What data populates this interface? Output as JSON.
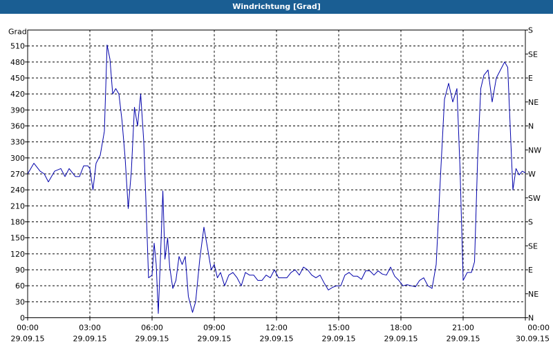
{
  "window": {
    "title": "Windrichtung [Grad]"
  },
  "chart_data": {
    "type": "line",
    "ylabel": "Grad",
    "ylim": [
      0,
      540
    ],
    "yticks": [
      0,
      30,
      60,
      90,
      120,
      150,
      180,
      210,
      240,
      270,
      300,
      330,
      360,
      390,
      420,
      450,
      480,
      510
    ],
    "right_ticks": [
      {
        "value": 0,
        "label": "N"
      },
      {
        "value": 45,
        "label": "NE"
      },
      {
        "value": 90,
        "label": "E"
      },
      {
        "value": 135,
        "label": "SE"
      },
      {
        "value": 180,
        "label": "S"
      },
      {
        "value": 225,
        "label": "SW"
      },
      {
        "value": 270,
        "label": "W"
      },
      {
        "value": 315,
        "label": "NW"
      },
      {
        "value": 360,
        "label": "N"
      },
      {
        "value": 405,
        "label": "NE"
      },
      {
        "value": 450,
        "label": "E"
      },
      {
        "value": 495,
        "label": "SE"
      },
      {
        "value": 540,
        "label": "S"
      }
    ],
    "xlim_hours": [
      0,
      24
    ],
    "xticks": [
      {
        "hour": 0,
        "time": "00:00",
        "date": "29.09.15"
      },
      {
        "hour": 3,
        "time": "03:00",
        "date": "29.09.15"
      },
      {
        "hour": 6,
        "time": "06:00",
        "date": "29.09.15"
      },
      {
        "hour": 9,
        "time": "09:00",
        "date": "29.09.15"
      },
      {
        "hour": 12,
        "time": "12:00",
        "date": "29.09.15"
      },
      {
        "hour": 15,
        "time": "15:00",
        "date": "29.09.15"
      },
      {
        "hour": 18,
        "time": "18:00",
        "date": "29.09.15"
      },
      {
        "hour": 21,
        "time": "21:00",
        "date": "29.09.15"
      },
      {
        "hour": 24,
        "time": "00:00",
        "date": "30.09.15"
      }
    ],
    "grid": true,
    "series": [
      {
        "color": "#0000aa",
        "points": [
          [
            0.0,
            270
          ],
          [
            0.3,
            290
          ],
          [
            0.6,
            275
          ],
          [
            0.8,
            270
          ],
          [
            1.0,
            255
          ],
          [
            1.3,
            275
          ],
          [
            1.6,
            280
          ],
          [
            1.8,
            265
          ],
          [
            2.0,
            280
          ],
          [
            2.3,
            265
          ],
          [
            2.5,
            265
          ],
          [
            2.7,
            285
          ],
          [
            2.9,
            285
          ],
          [
            3.0,
            280
          ],
          [
            3.15,
            240
          ],
          [
            3.3,
            290
          ],
          [
            3.5,
            305
          ],
          [
            3.7,
            350
          ],
          [
            3.83,
            512
          ],
          [
            3.97,
            485
          ],
          [
            4.1,
            420
          ],
          [
            4.25,
            430
          ],
          [
            4.4,
            420
          ],
          [
            4.55,
            370
          ],
          [
            4.7,
            300
          ],
          [
            4.85,
            205
          ],
          [
            5.0,
            275
          ],
          [
            5.15,
            395
          ],
          [
            5.3,
            360
          ],
          [
            5.45,
            420
          ],
          [
            5.6,
            330
          ],
          [
            5.72,
            200
          ],
          [
            5.83,
            75
          ],
          [
            6.0,
            80
          ],
          [
            6.1,
            140
          ],
          [
            6.2,
            100
          ],
          [
            6.3,
            8
          ],
          [
            6.42,
            130
          ],
          [
            6.52,
            238
          ],
          [
            6.62,
            110
          ],
          [
            6.75,
            150
          ],
          [
            6.85,
            95
          ],
          [
            7.0,
            55
          ],
          [
            7.15,
            70
          ],
          [
            7.3,
            115
          ],
          [
            7.45,
            100
          ],
          [
            7.6,
            115
          ],
          [
            7.75,
            40
          ],
          [
            7.95,
            10
          ],
          [
            8.1,
            30
          ],
          [
            8.3,
            110
          ],
          [
            8.5,
            170
          ],
          [
            8.7,
            125
          ],
          [
            8.85,
            90
          ],
          [
            9.0,
            100
          ],
          [
            9.15,
            75
          ],
          [
            9.3,
            85
          ],
          [
            9.5,
            60
          ],
          [
            9.7,
            80
          ],
          [
            9.9,
            85
          ],
          [
            10.1,
            75
          ],
          [
            10.3,
            60
          ],
          [
            10.5,
            85
          ],
          [
            10.7,
            80
          ],
          [
            10.9,
            80
          ],
          [
            11.1,
            70
          ],
          [
            11.3,
            70
          ],
          [
            11.5,
            80
          ],
          [
            11.7,
            75
          ],
          [
            11.9,
            90
          ],
          [
            12.1,
            75
          ],
          [
            12.3,
            75
          ],
          [
            12.5,
            75
          ],
          [
            12.7,
            85
          ],
          [
            12.9,
            90
          ],
          [
            13.1,
            80
          ],
          [
            13.3,
            95
          ],
          [
            13.5,
            90
          ],
          [
            13.7,
            80
          ],
          [
            13.9,
            75
          ],
          [
            14.1,
            80
          ],
          [
            14.3,
            65
          ],
          [
            14.5,
            52
          ],
          [
            14.7,
            57
          ],
          [
            14.9,
            60
          ],
          [
            15.1,
            60
          ],
          [
            15.3,
            80
          ],
          [
            15.5,
            85
          ],
          [
            15.7,
            78
          ],
          [
            15.9,
            78
          ],
          [
            16.1,
            72
          ],
          [
            16.3,
            88
          ],
          [
            16.5,
            88
          ],
          [
            16.7,
            80
          ],
          [
            16.9,
            88
          ],
          [
            17.1,
            82
          ],
          [
            17.3,
            80
          ],
          [
            17.5,
            95
          ],
          [
            17.7,
            78
          ],
          [
            17.9,
            70
          ],
          [
            18.1,
            60
          ],
          [
            18.3,
            62
          ],
          [
            18.5,
            60
          ],
          [
            18.7,
            58
          ],
          [
            18.9,
            70
          ],
          [
            19.1,
            75
          ],
          [
            19.3,
            60
          ],
          [
            19.5,
            55
          ],
          [
            19.7,
            100
          ],
          [
            19.9,
            260
          ],
          [
            20.1,
            410
          ],
          [
            20.3,
            440
          ],
          [
            20.5,
            405
          ],
          [
            20.7,
            430
          ],
          [
            20.85,
            280
          ],
          [
            21.0,
            70
          ],
          [
            21.2,
            85
          ],
          [
            21.4,
            85
          ],
          [
            21.55,
            105
          ],
          [
            21.7,
            300
          ],
          [
            21.85,
            430
          ],
          [
            22.0,
            455
          ],
          [
            22.2,
            465
          ],
          [
            22.4,
            405
          ],
          [
            22.6,
            450
          ],
          [
            22.8,
            465
          ],
          [
            23.0,
            480
          ],
          [
            23.15,
            470
          ],
          [
            23.3,
            330
          ],
          [
            23.4,
            240
          ],
          [
            23.55,
            280
          ],
          [
            23.7,
            268
          ],
          [
            23.85,
            275
          ],
          [
            24.0,
            272
          ]
        ]
      }
    ]
  }
}
